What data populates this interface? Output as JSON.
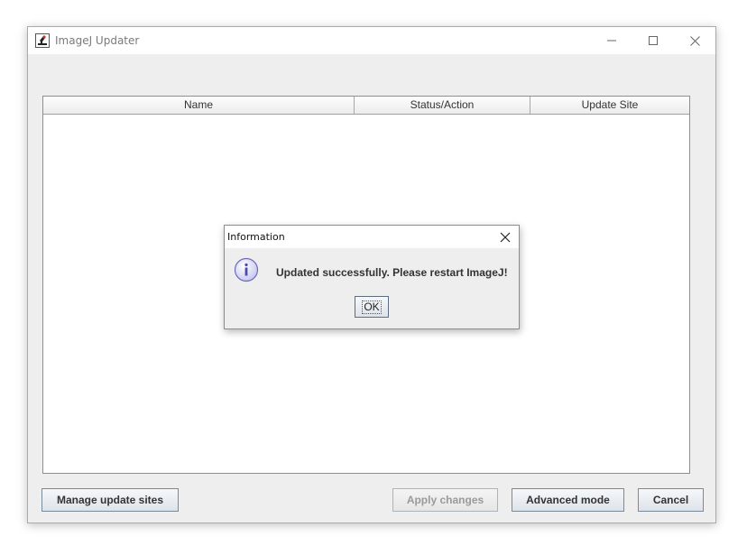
{
  "window": {
    "title": "ImageJ Updater",
    "icon": "imagej-microscope-icon",
    "controls": {
      "minimize": "minimize-icon",
      "maximize": "maximize-icon",
      "close": "close-icon"
    }
  },
  "table": {
    "columns": [
      "Name",
      "Status/Action",
      "Update Site"
    ],
    "rows": []
  },
  "buttons": {
    "manage": "Manage update sites",
    "apply": "Apply changes",
    "advanced": "Advanced mode",
    "cancel": "Cancel"
  },
  "dialog": {
    "title": "Information",
    "icon": "info-icon",
    "message": "Updated successfully.  Please restart ImageJ!",
    "ok": "OK"
  },
  "colors": {
    "window_bg": "#eeeeee",
    "info_icon_fill": "#d8d8f6",
    "info_icon_stroke": "#6b6bb8"
  }
}
